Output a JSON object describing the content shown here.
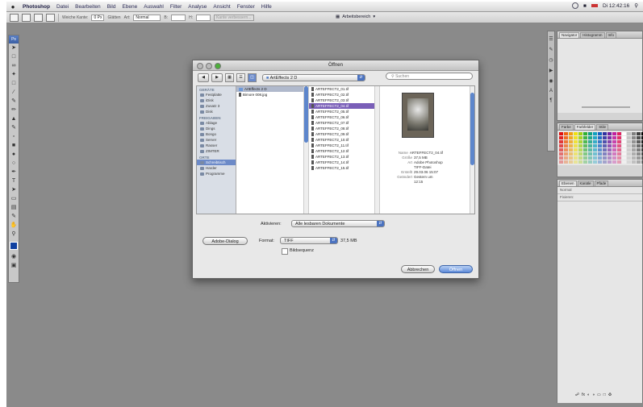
{
  "menubar": {
    "apple": "",
    "items": [
      "Photoshop",
      "Datei",
      "Bearbeiten",
      "Bild",
      "Ebene",
      "Auswahl",
      "Filter",
      "Analyse",
      "Ansicht",
      "Fenster",
      "Hilfe"
    ],
    "clock": "Di 12:42:16"
  },
  "options_bar": {
    "label_1": "Weiche Kante:",
    "value_1": "0 Px",
    "label_2": "Glätten",
    "label_3": "Art:",
    "value_3": "Normal",
    "label_4": "B:",
    "label_5": "H:",
    "button": "Kante verbessern...",
    "workspace": "Arbeitsbereich"
  },
  "panels": {
    "top_tabs": [
      "Navigator",
      "Histogramm",
      "Info"
    ],
    "swatch_tabs": [
      "Farbe",
      "Farbfelder",
      "Stile"
    ],
    "swatch_colors": [
      "#e01010",
      "#f06010",
      "#f0a010",
      "#f0e010",
      "#a0d010",
      "#30b030",
      "#10a080",
      "#10a0c0",
      "#1060c0",
      "#3030a0",
      "#7020a0",
      "#c020a0",
      "#e02060",
      "#ffffff",
      "#c0c0c0",
      "#808080",
      "#404040",
      "#000000"
    ],
    "layer_tabs": [
      "Ebenen",
      "Kanäle",
      "Pfade"
    ],
    "layer_rows": [
      "Normal",
      "Fixieren:"
    ]
  },
  "dialog": {
    "title": "Öffnen",
    "nav_back": "◀",
    "nav_fwd": "▶",
    "location": "ArtEffects 2 D",
    "search_placeholder": "Suchen",
    "sidebar": {
      "sections": [
        {
          "head": "GERÄTE",
          "items": [
            "Festplatte",
            "iDisk",
            "Zusatz 3",
            "Disk"
          ]
        },
        {
          "head": "FREIGABEN",
          "items": [
            "Ablage",
            "Dings",
            "Bongo",
            "Server",
            "Rasser",
            "ZIMTER"
          ]
        },
        {
          "head": "ORTE",
          "items": [
            "Schreibtisch",
            "Harder",
            "Programme"
          ]
        }
      ]
    },
    "column1": [
      "ArtEffects 2 D",
      "Bimore 008.jpg"
    ],
    "column2": [
      "ARTEFFECT2_01.tif",
      "ARTEFFECT2_02.tif",
      "ARTEFFECT2_03.tif",
      "ARTEFFECT2_04.tif",
      "ARTEFFECT2_05.tif",
      "ARTEFFECT2_06.tif",
      "ARTEFFECT2_07.tif",
      "ARTEFFECT2_08.tif",
      "ARTEFFECT2_09.tif",
      "ARTEFFECT2_10.tif",
      "ARTEFFECT2_11.tif",
      "ARTEFFECT2_12.tif",
      "ARTEFFECT2_13.tif",
      "ARTEFFECT2_14.tif",
      "ARTEFFECT2_15.tif"
    ],
    "preview_meta": [
      {
        "k": "Name",
        "v": "ARTEFFECT2_04.tif"
      },
      {
        "k": "Größe",
        "v": "37,5 MB"
      },
      {
        "k": "Art",
        "v": "Adobe Photoshop TIFF-Datei"
      },
      {
        "k": "Erstellt",
        "v": "29.03.06 15:07"
      },
      {
        "k": "Geändert",
        "v": "Gestern um 12:15"
      }
    ],
    "enable_label": "Aktivieren:",
    "enable_value": "Alle lesbaren Dokumente",
    "adobe_dialog": "Adobe-Dialog",
    "format_label": "Format:",
    "format_value": "TIFF",
    "format_size": "37,5 MB",
    "image_sequence": "Bildsequenz",
    "cancel": "Abbrechen",
    "open": "Öffnen"
  }
}
